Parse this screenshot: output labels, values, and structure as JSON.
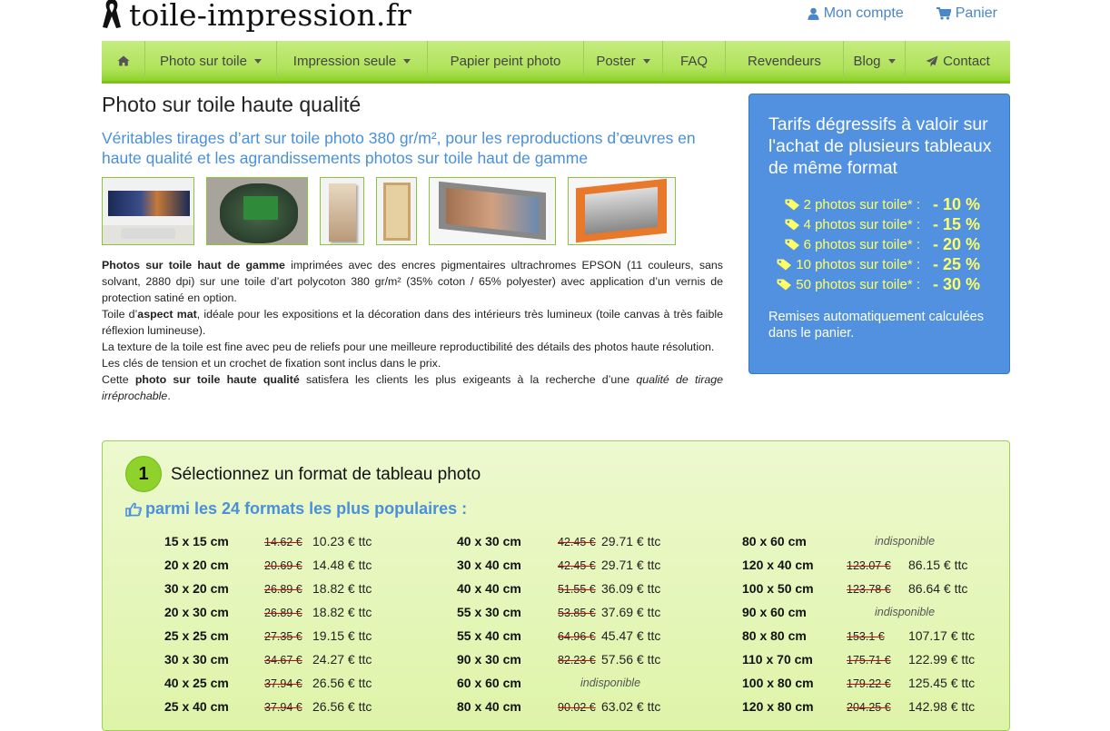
{
  "site": {
    "logo_text": "toile-impression.fr",
    "account_label": "Mon compte",
    "cart_label": "Panier"
  },
  "nav": {
    "home_icon": "home-icon",
    "items": [
      {
        "label": "Photo sur toile",
        "dropdown": true
      },
      {
        "label": "Impression seule",
        "dropdown": true
      },
      {
        "label": "Papier peint photo",
        "dropdown": false
      },
      {
        "label": "Poster",
        "dropdown": true
      },
      {
        "label": "FAQ",
        "dropdown": false
      },
      {
        "label": "Revendeurs",
        "dropdown": false
      },
      {
        "label": "Blog",
        "dropdown": true
      },
      {
        "label": "Contact",
        "dropdown": false
      }
    ]
  },
  "main": {
    "title": "Photo sur toile haute qualité",
    "subtitle": "Véritables tirages d’art sur toile photo 380 gr/m², pour les reproductions d’œuvres en haute qualité et les agrandissements photos sur toile haut de gamme",
    "desc": {
      "p1_bold": "Photos sur toile haut de gamme",
      "p1_rest": " imprimées avec des encres pigmentaires ultrachromes EPSON (11 couleurs, sans solvant, 2880 dpi) sur une toile d’art polycoton 380 gr/m² (35% coton / 65% polyester) avec application d’un vernis de protection satiné en option.",
      "p2_pre": "Toile d’",
      "p2_bold": "aspect mat",
      "p2_rest": ", idéale pour les expositions et la décoration dans des intérieurs très lumineux (toile canvas à très faible réflexion lumineuse).",
      "p3": "La texture de la toile est fine avec peu de reliefs pour une meilleure reproductibilité des détails des photos haute résolution.",
      "p4": "Les clés de tension et un crochet de fixation sont inclus dans le prix.",
      "p5_pre": "Cette ",
      "p5_bold": "photo sur toile haute qualité",
      "p5_mid": " satisfera les clients les plus exigeants à la recherche d’une ",
      "p5_ital": "qualité de tirage irréprochable",
      "p5_end": "."
    }
  },
  "promo": {
    "title": "Tarifs dégressifs à valoir sur l'achat de plusieurs tableaux de même format",
    "tag_icon": "tag-icon",
    "discounts": [
      {
        "label": "2 photos sur toile* :",
        "value": "- 10 %"
      },
      {
        "label": "4 photos sur toile* :",
        "value": "- 15 %"
      },
      {
        "label": "6 photos sur toile* :",
        "value": "- 20 %"
      },
      {
        "label": "10 photos sur toile* :",
        "value": "- 25 %"
      },
      {
        "label": "50 photos sur toile* :",
        "value": "- 30 %"
      }
    ],
    "footer": "Remises automatiquement calculées dans le panier."
  },
  "formats": {
    "step_number": "1",
    "step_title": "Sélectionnez un format de tableau photo",
    "popular_label": "parmi les 24 formats les plus populaires :",
    "columns": [
      [
        {
          "size": "15 x 15 cm",
          "old": "14.62 €",
          "new": "10.23 € ttc"
        },
        {
          "size": "20 x 20 cm",
          "old": "20.69 €",
          "new": "14.48 € ttc"
        },
        {
          "size": "30 x 20 cm",
          "old": "26.89 €",
          "new": "18.82 € ttc"
        },
        {
          "size": "20 x 30 cm",
          "old": "26.89 €",
          "new": "18.82 € ttc"
        },
        {
          "size": "25 x 25 cm",
          "old": "27.35 €",
          "new": "19.15 € ttc"
        },
        {
          "size": "30 x 30 cm",
          "old": "34.67 €",
          "new": "24.27 € ttc"
        },
        {
          "size": "40 x 25 cm",
          "old": "37.94 €",
          "new": "26.56 € ttc"
        },
        {
          "size": "25 x 40 cm",
          "old": "37.94 €",
          "new": "26.56 € ttc"
        }
      ],
      [
        {
          "size": "40 x 30 cm",
          "old": "42.45 €",
          "new": "29.71 € ttc"
        },
        {
          "size": "30 x 40 cm",
          "old": "42.45 €",
          "new": "29.71 € ttc"
        },
        {
          "size": "40 x 40 cm",
          "old": "51.55 €",
          "new": "36.09 € ttc"
        },
        {
          "size": "55 x 30 cm",
          "old": "53.85 €",
          "new": "37.69 € ttc"
        },
        {
          "size": "55 x 40 cm",
          "old": "64.96 €",
          "new": "45.47 € ttc"
        },
        {
          "size": "90 x 30 cm",
          "old": "82.23 €",
          "new": "57.56 € ttc"
        },
        {
          "size": "60 x 60 cm",
          "unavailable": "indisponible"
        },
        {
          "size": "80 x 40 cm",
          "old": "90.02 €",
          "new": "63.02 € ttc"
        }
      ],
      [
        {
          "size": "80 x 60 cm",
          "unavailable": "indisponible"
        },
        {
          "size": "120 x 40 cm",
          "old": "123.07 €",
          "new": "86.15 € ttc"
        },
        {
          "size": "100 x 50 cm",
          "old": "123.78 €",
          "new": "86.64 € ttc"
        },
        {
          "size": "90 x 60 cm",
          "unavailable": "indisponible"
        },
        {
          "size": "80 x 80 cm",
          "old": "153.1 €",
          "new": "107.17 € ttc"
        },
        {
          "size": "110 x 70 cm",
          "old": "175.71 €",
          "new": "122.99 € ttc"
        },
        {
          "size": "100 x 80 cm",
          "old": "179.22 €",
          "new": "125.45 € ttc"
        },
        {
          "size": "120 x 80 cm",
          "old": "204.25 €",
          "new": "142.98 € ttc"
        }
      ]
    ]
  },
  "colors": {
    "accent_blue": "#4a90d9",
    "promo_blue": "#5191e0",
    "promo_yellow": "#ffff66",
    "nav_green": "#b0e25a",
    "strike_red": "#dd0000"
  }
}
